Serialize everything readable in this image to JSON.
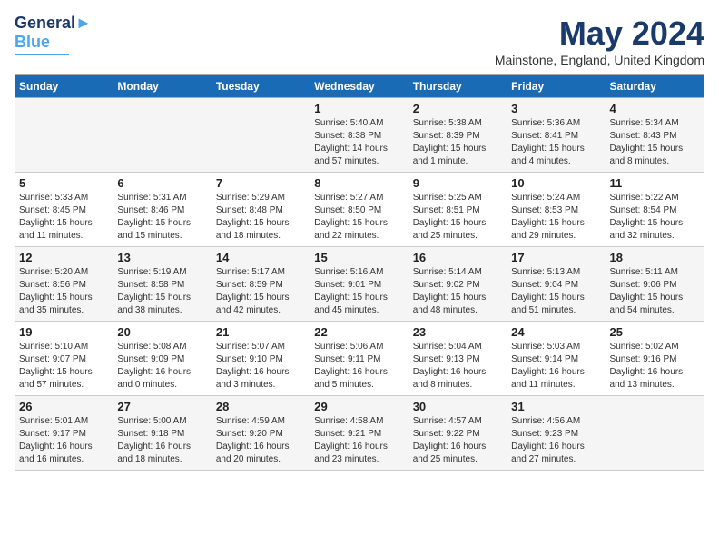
{
  "logo": {
    "line1": "General",
    "line2": "Blue"
  },
  "title": "May 2024",
  "location": "Mainstone, England, United Kingdom",
  "days_of_week": [
    "Sunday",
    "Monday",
    "Tuesday",
    "Wednesday",
    "Thursday",
    "Friday",
    "Saturday"
  ],
  "weeks": [
    [
      {
        "day": "",
        "content": ""
      },
      {
        "day": "",
        "content": ""
      },
      {
        "day": "",
        "content": ""
      },
      {
        "day": "1",
        "content": "Sunrise: 5:40 AM\nSunset: 8:38 PM\nDaylight: 14 hours\nand 57 minutes."
      },
      {
        "day": "2",
        "content": "Sunrise: 5:38 AM\nSunset: 8:39 PM\nDaylight: 15 hours\nand 1 minute."
      },
      {
        "day": "3",
        "content": "Sunrise: 5:36 AM\nSunset: 8:41 PM\nDaylight: 15 hours\nand 4 minutes."
      },
      {
        "day": "4",
        "content": "Sunrise: 5:34 AM\nSunset: 8:43 PM\nDaylight: 15 hours\nand 8 minutes."
      }
    ],
    [
      {
        "day": "5",
        "content": "Sunrise: 5:33 AM\nSunset: 8:45 PM\nDaylight: 15 hours\nand 11 minutes."
      },
      {
        "day": "6",
        "content": "Sunrise: 5:31 AM\nSunset: 8:46 PM\nDaylight: 15 hours\nand 15 minutes."
      },
      {
        "day": "7",
        "content": "Sunrise: 5:29 AM\nSunset: 8:48 PM\nDaylight: 15 hours\nand 18 minutes."
      },
      {
        "day": "8",
        "content": "Sunrise: 5:27 AM\nSunset: 8:50 PM\nDaylight: 15 hours\nand 22 minutes."
      },
      {
        "day": "9",
        "content": "Sunrise: 5:25 AM\nSunset: 8:51 PM\nDaylight: 15 hours\nand 25 minutes."
      },
      {
        "day": "10",
        "content": "Sunrise: 5:24 AM\nSunset: 8:53 PM\nDaylight: 15 hours\nand 29 minutes."
      },
      {
        "day": "11",
        "content": "Sunrise: 5:22 AM\nSunset: 8:54 PM\nDaylight: 15 hours\nand 32 minutes."
      }
    ],
    [
      {
        "day": "12",
        "content": "Sunrise: 5:20 AM\nSunset: 8:56 PM\nDaylight: 15 hours\nand 35 minutes."
      },
      {
        "day": "13",
        "content": "Sunrise: 5:19 AM\nSunset: 8:58 PM\nDaylight: 15 hours\nand 38 minutes."
      },
      {
        "day": "14",
        "content": "Sunrise: 5:17 AM\nSunset: 8:59 PM\nDaylight: 15 hours\nand 42 minutes."
      },
      {
        "day": "15",
        "content": "Sunrise: 5:16 AM\nSunset: 9:01 PM\nDaylight: 15 hours\nand 45 minutes."
      },
      {
        "day": "16",
        "content": "Sunrise: 5:14 AM\nSunset: 9:02 PM\nDaylight: 15 hours\nand 48 minutes."
      },
      {
        "day": "17",
        "content": "Sunrise: 5:13 AM\nSunset: 9:04 PM\nDaylight: 15 hours\nand 51 minutes."
      },
      {
        "day": "18",
        "content": "Sunrise: 5:11 AM\nSunset: 9:06 PM\nDaylight: 15 hours\nand 54 minutes."
      }
    ],
    [
      {
        "day": "19",
        "content": "Sunrise: 5:10 AM\nSunset: 9:07 PM\nDaylight: 15 hours\nand 57 minutes."
      },
      {
        "day": "20",
        "content": "Sunrise: 5:08 AM\nSunset: 9:09 PM\nDaylight: 16 hours\nand 0 minutes."
      },
      {
        "day": "21",
        "content": "Sunrise: 5:07 AM\nSunset: 9:10 PM\nDaylight: 16 hours\nand 3 minutes."
      },
      {
        "day": "22",
        "content": "Sunrise: 5:06 AM\nSunset: 9:11 PM\nDaylight: 16 hours\nand 5 minutes."
      },
      {
        "day": "23",
        "content": "Sunrise: 5:04 AM\nSunset: 9:13 PM\nDaylight: 16 hours\nand 8 minutes."
      },
      {
        "day": "24",
        "content": "Sunrise: 5:03 AM\nSunset: 9:14 PM\nDaylight: 16 hours\nand 11 minutes."
      },
      {
        "day": "25",
        "content": "Sunrise: 5:02 AM\nSunset: 9:16 PM\nDaylight: 16 hours\nand 13 minutes."
      }
    ],
    [
      {
        "day": "26",
        "content": "Sunrise: 5:01 AM\nSunset: 9:17 PM\nDaylight: 16 hours\nand 16 minutes."
      },
      {
        "day": "27",
        "content": "Sunrise: 5:00 AM\nSunset: 9:18 PM\nDaylight: 16 hours\nand 18 minutes."
      },
      {
        "day": "28",
        "content": "Sunrise: 4:59 AM\nSunset: 9:20 PM\nDaylight: 16 hours\nand 20 minutes."
      },
      {
        "day": "29",
        "content": "Sunrise: 4:58 AM\nSunset: 9:21 PM\nDaylight: 16 hours\nand 23 minutes."
      },
      {
        "day": "30",
        "content": "Sunrise: 4:57 AM\nSunset: 9:22 PM\nDaylight: 16 hours\nand 25 minutes."
      },
      {
        "day": "31",
        "content": "Sunrise: 4:56 AM\nSunset: 9:23 PM\nDaylight: 16 hours\nand 27 minutes."
      },
      {
        "day": "",
        "content": ""
      }
    ]
  ]
}
